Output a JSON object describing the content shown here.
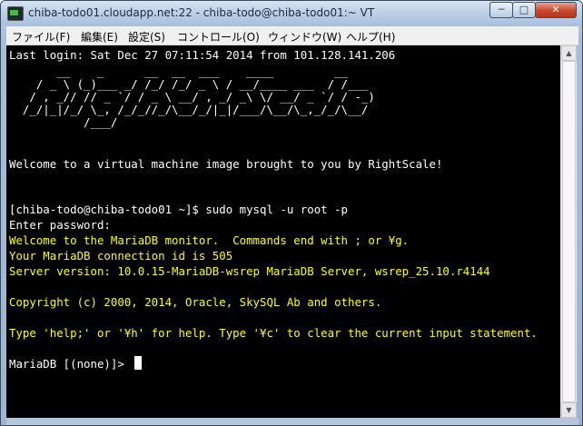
{
  "window": {
    "title": "chiba-todo01.cloudapp.net:22 - chiba-todo@chiba-todo01:~ VT",
    "controls": {
      "minimize": "─",
      "maximize": "□",
      "close": "✕"
    }
  },
  "menu": [
    {
      "label": "ファイル(F)"
    },
    {
      "label": "編集(E)"
    },
    {
      "label": "設定(S)"
    },
    {
      "label": "コントロール(O)"
    },
    {
      "label": "ウィンドウ(W)"
    },
    {
      "label": "ヘルプ(H)"
    }
  ],
  "terminal": {
    "last_login": "Last login: Sat Dec 27 07:11:54 2014 from 101.128.141.206",
    "banner": [
      "       __    _      __  __  ___    ____         __",
      "    / _ \\ (_)___ _/ /_/ /_/ _ \\ / __/____ ___  / /___",
      "   / , _// // _ `/ / _ \\ __/ , _/ _\\ \\/ __/ _ `/ / -_)",
      "  /_/|_|/_/ \\_, /_/_//_/\\__/_/|_|/___/\\__/\\_,_/_/\\__/",
      "           /___/"
    ],
    "welcome": "Welcome to a virtual machine image brought to you by RightScale!",
    "prompt_cmd": "[chiba-todo@chiba-todo01 ~]$ sudo mysql -u root -p",
    "enter_password": "Enter password:",
    "maria_welcome": "Welcome to the MariaDB monitor.  Commands end with ; or ¥g.",
    "connection_id": "Your MariaDB connection id is 505",
    "server_version": "Server version: 10.0.15-MariaDB-wsrep MariaDB Server, wsrep_25.10.r4144",
    "copyright": "Copyright (c) 2000, 2014, Oracle, SkySQL Ab and others.",
    "help_hint": "Type 'help;' or '¥h' for help. Type '¥c' to clear the current input statement.",
    "maria_prompt": "MariaDB [(none)]> "
  },
  "scrollbar": {
    "up_arrow": "▲",
    "down_arrow": "▼"
  },
  "colors": {
    "terminal_bg": "#000000",
    "text": "#ffffff",
    "highlight": "#ffff00"
  }
}
